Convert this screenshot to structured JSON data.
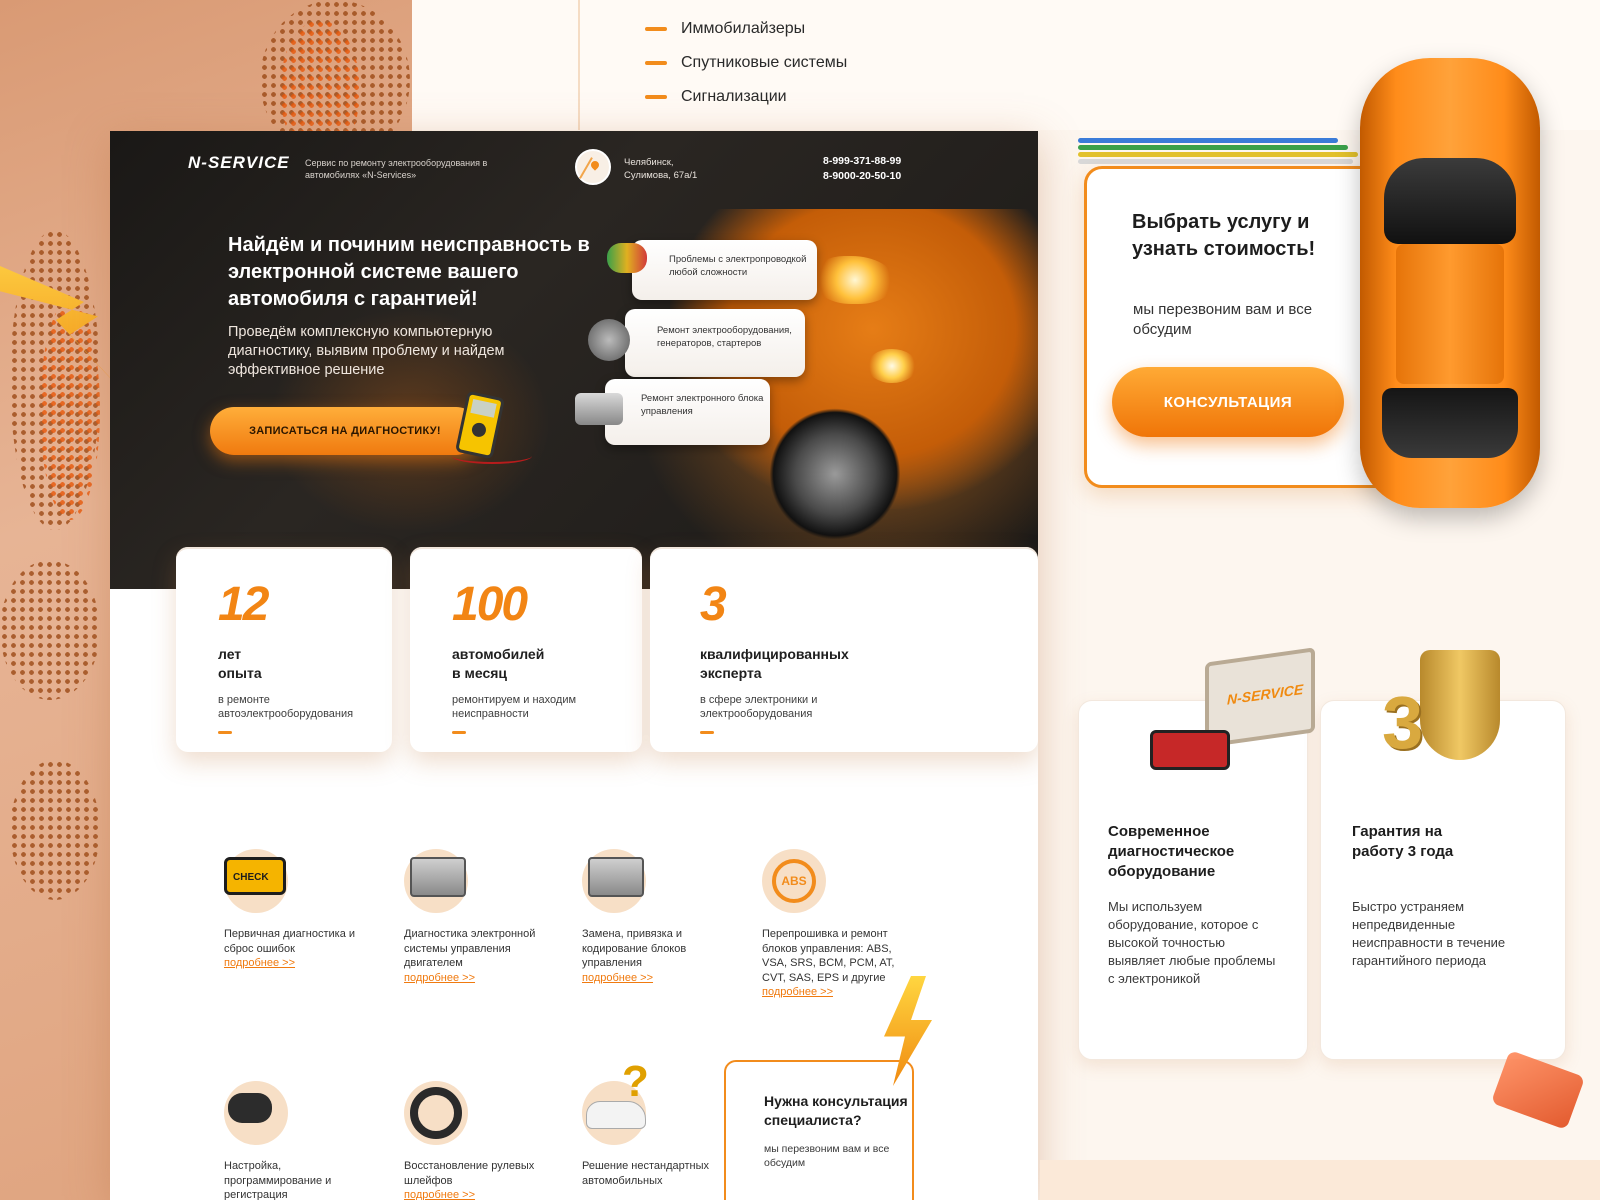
{
  "top_menu": [
    "Иммобилайзеры",
    "Спутниковые системы",
    "Сигнализации"
  ],
  "header": {
    "logo": "N-SERVICE",
    "tagline": "Сервис по ремонту электрооборудования в автомобилях «N-Services»",
    "address_line1": "Челябинск,",
    "address_line2": "Сулимова, 67а/1",
    "phone1": "8-999-371-88-99",
    "phone2": "8-9000-20-50-10"
  },
  "hero": {
    "title": "Найдём и починим неисправность в электронной системе вашего автомобиля с гарантией!",
    "subtitle": "Проведём комплексную компьютерную диагностику, выявим проблему и найдем эффективное решение",
    "cta": "ЗАПИСАТЬСЯ НА ДИАГНОСТИКУ!"
  },
  "features": [
    "Проблемы с электропроводкой любой сложности",
    "Ремонт электрооборудования, генераторов, стартеров",
    "Ремонт электронного блока управления"
  ],
  "stats": [
    {
      "number": "12",
      "label_line1": "лет",
      "label_line2": "опыта",
      "sub": "в ремонте автоэлектрооборудования"
    },
    {
      "number": "100",
      "label_line1": "автомобилей",
      "label_line2": "в месяц",
      "sub": "ремонтируем и находим неисправности"
    },
    {
      "number": "3",
      "label_line1": "квалифицированных",
      "label_line2": "эксперта",
      "sub": "в сфере электроники и электрооборудования"
    }
  ],
  "services": [
    {
      "text": "Первичная диагностика и сброс ошибок",
      "more": "подробнее >>",
      "icon": "check-engine-icon"
    },
    {
      "text": "Диагностика электронной системы управления двигателем",
      "more": "подробнее >>",
      "icon": "ecu-icon"
    },
    {
      "text": "Замена, привязка и кодирование блоков управления",
      "more": "подробнее >>",
      "icon": "control-unit-icon"
    },
    {
      "text": "Перепрошивка и ремонт блоков управления: ABS, VSA, SRS, BCM, PCM, AT, CVT, SAS, EPS и другие",
      "more": "подробнее >>",
      "icon": "abs-icon"
    },
    {
      "text": "Настройка, программирование и регистрация",
      "icon": "car-key-icon"
    },
    {
      "text": "Восстановление рулевых шлейфов",
      "more": "подробнее >>",
      "icon": "steering-wheel-icon"
    },
    {
      "text": "Решение нестандартных автомобильных",
      "icon": "car-question-icon"
    }
  ],
  "consult_mini": {
    "title": "Нужна консультация специалиста?",
    "sub": "мы перезвоним вам и все обсудим"
  },
  "consult_big": {
    "title": "Выбрать услугу и узнать стоимость!",
    "sub": "мы перезвоним вам и все обсудим",
    "button": "КОНСУЛЬТАЦИЯ"
  },
  "advantages": [
    {
      "title": "Современное диагностическое оборудование",
      "text": "Мы используем оборудование, которое с высокой точностью выявляет любые проблемы с электроникой"
    },
    {
      "title": "Гарантия на работу 3 года",
      "text": "Быстро устраняем непредвиденные неисправности в течение гарантийного периода"
    }
  ],
  "colors": {
    "accent": "#f28c1c",
    "dark": "#1b1917",
    "bg": "#fdf6ef"
  }
}
